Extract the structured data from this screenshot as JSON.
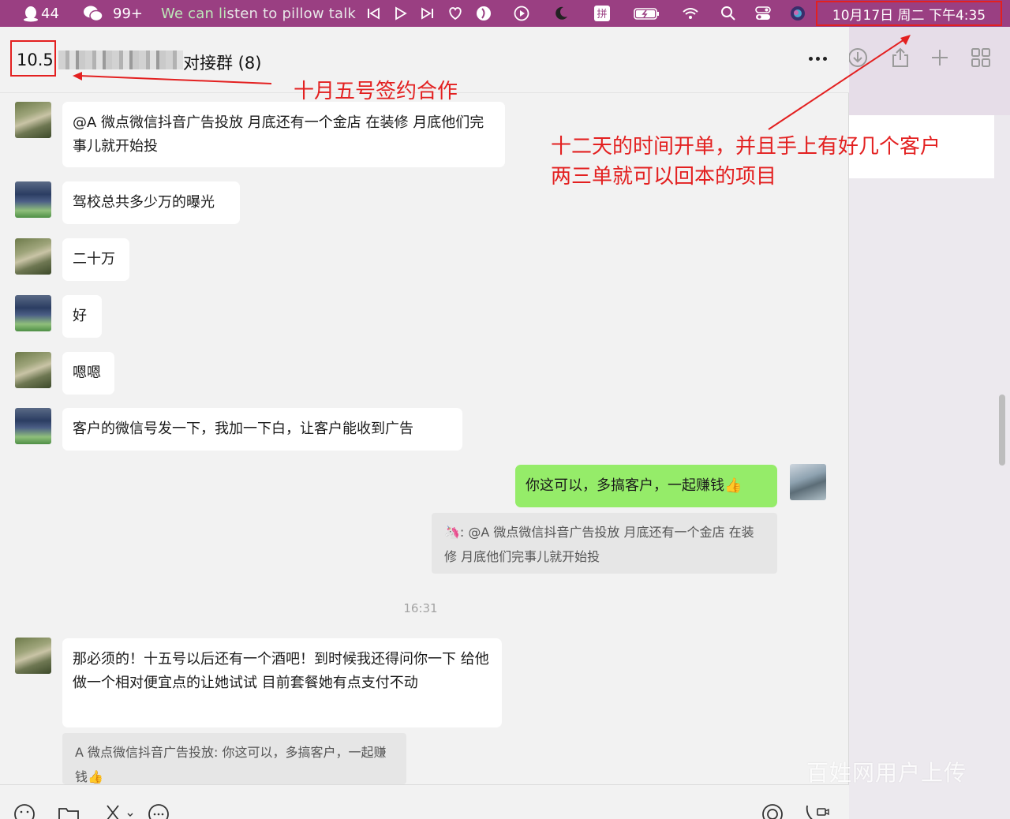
{
  "menubar": {
    "qq_count": "44",
    "wechat_count": "99+",
    "song_part1": "We can li",
    "song_part2": "sten to pillow talk",
    "datetime": "10月17日 周二 下午4:35"
  },
  "chat": {
    "title_prefix": "10.5",
    "title_suffix": "对接群 (8)",
    "messages": [
      {
        "text": "@A 微点微信抖音广告投放  月底还有一个金店 在装修 月底他们完事儿就开始投"
      },
      {
        "text": "驾校总共多少万的曝光"
      },
      {
        "text": "二十万"
      },
      {
        "text": "好"
      },
      {
        "text": "嗯嗯"
      },
      {
        "text": "客户的微信号发一下，我加一下白，让客户能收到广告"
      },
      {
        "text": "你这可以，多搞客户，一起赚钱👍"
      },
      {
        "quote": "🦄: @A 微点微信抖音广告投放  月底还有一个金店 在装修 月底他们完事儿就开始投"
      },
      {
        "text": "那必须的！十五号以后还有一个酒吧！到时候我还得问你一下 给他做一个相对便宜点的让她试试 目前套餐她有点支付不动"
      },
      {
        "quote": "A 微点微信抖音广告投放: 你这可以，多搞客户，一起赚钱👍"
      }
    ],
    "time_separator": "16:31"
  },
  "annotations": {
    "sign_date": "十月五号签约合作",
    "line1": "十二天的时间开单，并且手上有好几个客户",
    "line2": "两三单就可以回本的项目"
  },
  "watermark": "百姓网用户上传",
  "colors": {
    "menubar": "#9a3f82",
    "annotation": "#e32020",
    "my_bubble": "#95ec69"
  }
}
